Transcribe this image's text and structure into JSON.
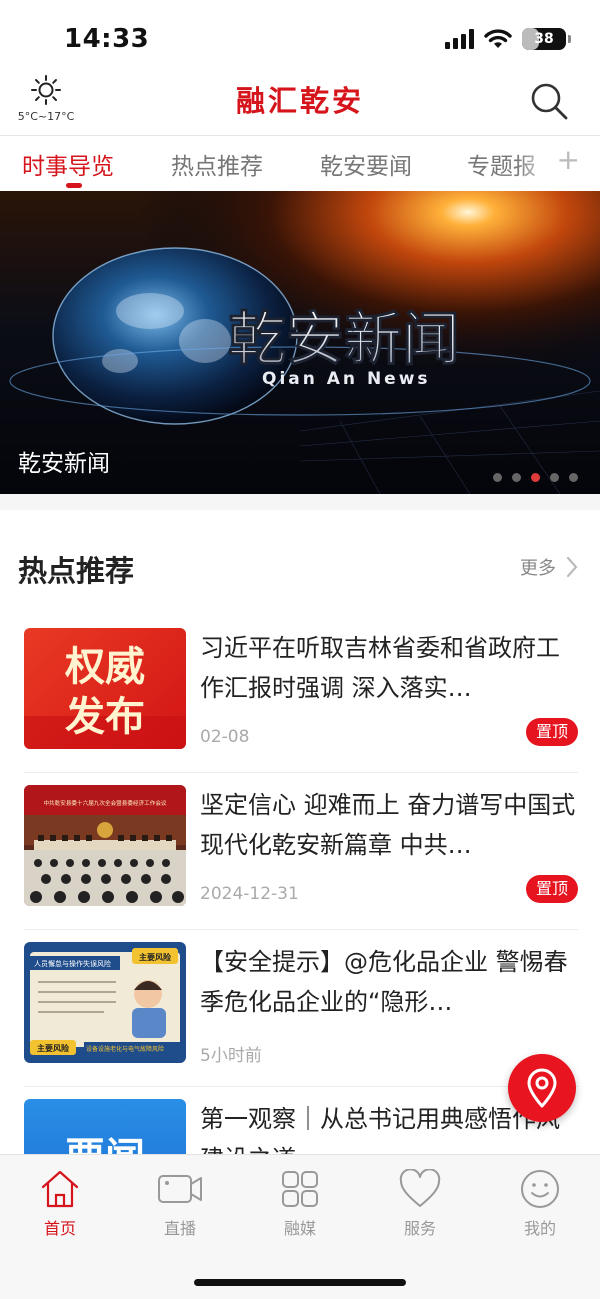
{
  "status_bar": {
    "time": "14:33",
    "battery": "38",
    "battery_level": 0.38
  },
  "header": {
    "weather_icon": "sun-icon",
    "weather_text": "5°C~17°C",
    "title": "融汇乾安",
    "search_icon": "search-icon"
  },
  "tabs": [
    {
      "label": "时事导览",
      "active": true
    },
    {
      "label": "热点推荐",
      "active": false
    },
    {
      "label": "乾安要闻",
      "active": false
    },
    {
      "label": "专题报",
      "active": false
    }
  ],
  "tab_add": "+",
  "banner": {
    "headline": "乾安新闻",
    "subtitle": "Qian An News",
    "caption": "乾安新闻",
    "slide_count": 5,
    "active_slide": 3
  },
  "section": {
    "title": "热点推荐",
    "more_label": "更多"
  },
  "news": [
    {
      "title": "习近平在听取吉林省委和省政府工作汇报时强调 深入落实…",
      "date": "02-08",
      "pinned": "置顶",
      "thumb_text": [
        "权威",
        "发布"
      ]
    },
    {
      "title": "坚定信心 迎难而上 奋力谱写中国式现代化乾安新篇章 中共…",
      "date": "2024-12-31",
      "pinned": "置顶",
      "thumb_text": [
        "中共乾安县委十六届九次全会暨县委经济工作会议"
      ]
    },
    {
      "title": "【安全提示】@危化品企业 警惕春季危化品企业的“隐形…",
      "date": "5小时前",
      "pinned": "",
      "thumb_text": [
        "人员懈怠与操作失误风险",
        "主要风险",
        "主要风险",
        "设备设施老化与电气故障风险"
      ]
    },
    {
      "title": "第一观察｜从总书记用典感悟作风建设之道",
      "date": "",
      "pinned": "",
      "thumb_text": [
        "要闻"
      ]
    }
  ],
  "bottom_nav": [
    {
      "label": "首页",
      "icon": "home-icon",
      "active": true
    },
    {
      "label": "直播",
      "icon": "video-camera-icon",
      "active": false
    },
    {
      "label": "融媒",
      "icon": "grid-icon",
      "active": false
    },
    {
      "label": "服务",
      "icon": "heart-icon",
      "active": false
    },
    {
      "label": "我的",
      "icon": "smiley-icon",
      "active": false
    }
  ],
  "colors": {
    "brand_red": "#d6141c",
    "nav_inactive": "#999999"
  }
}
